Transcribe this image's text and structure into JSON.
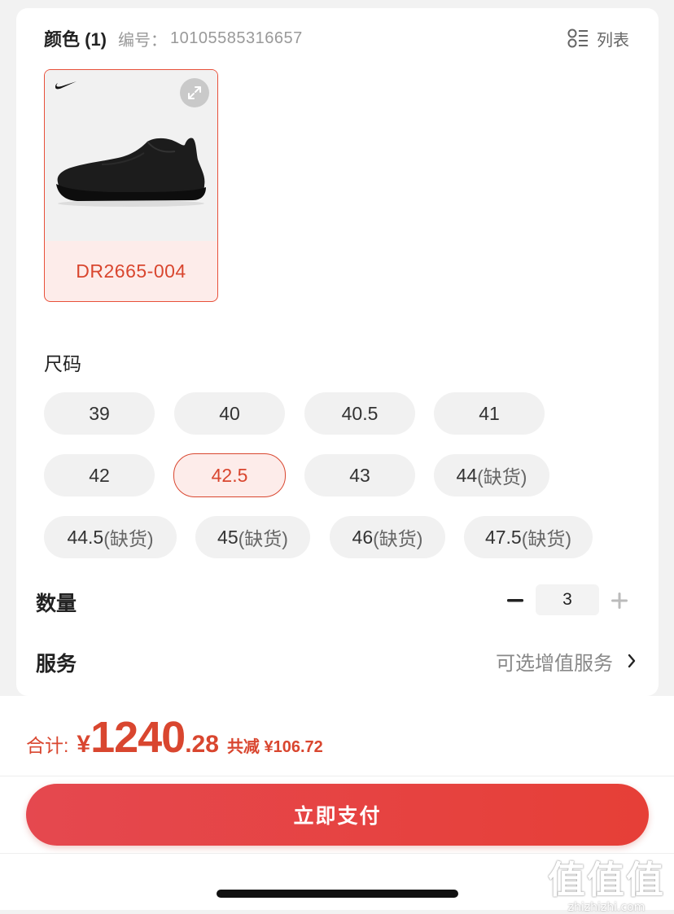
{
  "color_section": {
    "title": "颜色 (1)",
    "sku_label": "编号：",
    "sku_number": "10105585316657",
    "list_toggle_label": "列表",
    "icons": {
      "list": "list-view-icon",
      "expand": "expand-icon",
      "brand": "nike-swoosh-logo"
    }
  },
  "product": {
    "code": "DR2665-004",
    "selected": true,
    "image": "black-running-shoe"
  },
  "size_section": {
    "title": "尺码",
    "sizes": [
      {
        "value": "39",
        "status": "",
        "selected": false
      },
      {
        "value": "40",
        "status": "",
        "selected": false
      },
      {
        "value": "40.5",
        "status": "",
        "selected": false
      },
      {
        "value": "41",
        "status": "",
        "selected": false
      },
      {
        "value": "42",
        "status": "",
        "selected": false
      },
      {
        "value": "42.5",
        "status": "",
        "selected": true
      },
      {
        "value": "43",
        "status": "",
        "selected": false
      },
      {
        "value": "44",
        "status": "(缺货)",
        "selected": false
      },
      {
        "value": "44.5",
        "status": "(缺货)",
        "selected": false
      },
      {
        "value": "45",
        "status": "(缺货)",
        "selected": false
      },
      {
        "value": "46",
        "status": "(缺货)",
        "selected": false
      },
      {
        "value": "47.5",
        "status": "(缺货)",
        "selected": false
      }
    ]
  },
  "quantity": {
    "label": "数量",
    "value": "3",
    "minus_icon": "minus-icon",
    "plus_icon": "plus-icon"
  },
  "service": {
    "label": "服务",
    "link_text": "可选增值服务",
    "chevron": "›"
  },
  "footer": {
    "total_label": "合计:",
    "currency": "¥",
    "total_integer": "1240",
    "total_decimal": ".28",
    "discount_text": "共减 ¥106.72",
    "pay_button_label": "立即支付"
  },
  "watermark": {
    "text": "值值值",
    "url": "zhizhizhi.com"
  },
  "colors": {
    "accent": "#d9462f",
    "selected_bg": "#fdecea",
    "chip_bg": "#f1f1f1",
    "pay_button": "#e5484f"
  }
}
